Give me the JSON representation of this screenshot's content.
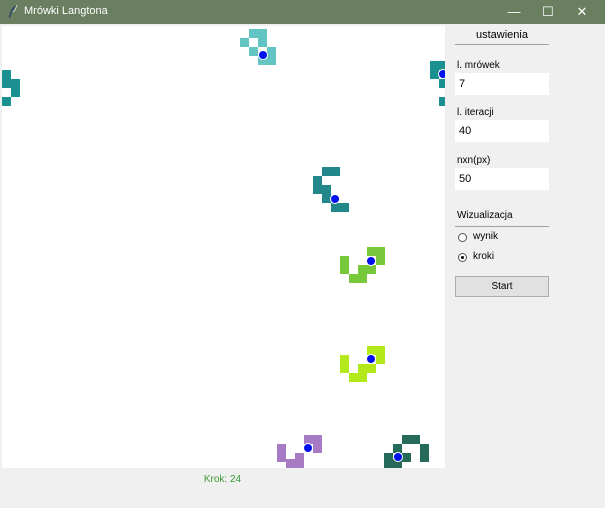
{
  "window": {
    "title": "Mrówki Langtona",
    "controls": {
      "minimize": "—",
      "maximize": "☐",
      "close": "✕"
    }
  },
  "status": {
    "step_label": "Krok: 24"
  },
  "settings": {
    "header": "ustawienia",
    "ant_count": {
      "label": "l. mrówek",
      "value": "7"
    },
    "iterations": {
      "label": "l. iteracji",
      "value": "40"
    },
    "grid_size": {
      "label": "nxn(px)",
      "value": "50"
    },
    "visualization": {
      "header": "Wizualizacja",
      "options": [
        "wynik",
        "kroki"
      ],
      "selected": "kroki"
    },
    "start_label": "Start"
  },
  "colors": {
    "titlebar": "#6a7f60",
    "ant_marker": "#0010ee",
    "ant_trails": [
      "#63c4c4",
      "#1a9090",
      "#21878a",
      "#77c93b",
      "#b3e81b",
      "#a77ac4",
      "#266a5a"
    ]
  }
}
